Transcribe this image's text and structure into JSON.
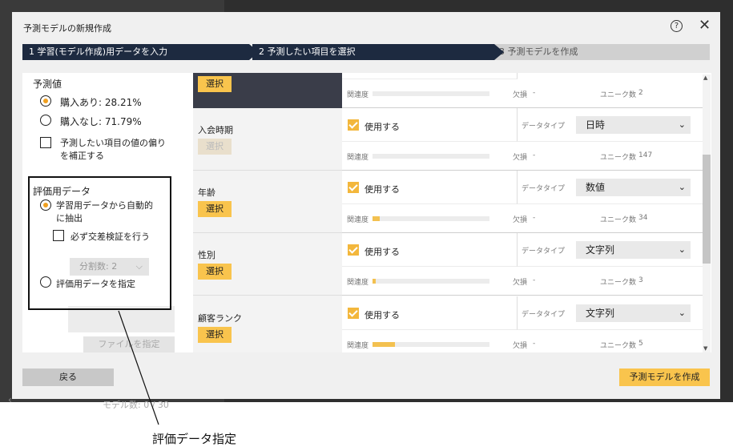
{
  "background": {
    "footer_text": "モデル数: 0 / 30",
    "back_arrow": "‹"
  },
  "dialog": {
    "title": "予測モデルの新規作成",
    "help_icon": "?",
    "close_icon": "✕",
    "steps": [
      {
        "label": "1 学習(モデル作成)用データを入力",
        "state": "done"
      },
      {
        "label": "2 予測したい項目を選択",
        "state": "active"
      },
      {
        "label": "3 予測モデルを作成",
        "state": "pending"
      }
    ]
  },
  "left_panel": {
    "prediction_heading": "予測値",
    "options": [
      {
        "label": "購入あり: 28.21%",
        "selected": true
      },
      {
        "label": "購入なし: 71.79%",
        "selected": false
      }
    ],
    "bias_correct_line1": "予測したい項目の値の偏り",
    "bias_correct_line2": "を補正する",
    "eval_heading": "評価用データ",
    "eval_auto_line1": "学習用データから自動的",
    "eval_auto_line2": "に抽出",
    "cross_validation": "必ず交差検証を行う",
    "splits_select": "分割数: 2",
    "eval_specify": "評価用データを指定",
    "file_button": "ファイルを指定"
  },
  "right_panel": {
    "select_label": "選択",
    "use_label": "使用する",
    "datatype_label": "データタイプ",
    "relevance_label": "関連度",
    "missing_label": "欠損",
    "missing_value": "-",
    "unique_label": "ユニーク数",
    "top_row": {
      "unique": "2",
      "relevance": 0.0
    },
    "rows": [
      {
        "name": "入会時期",
        "datatype": "日時",
        "unique": "147",
        "relevance": 0.0,
        "select_disabled": true
      },
      {
        "name": "年齢",
        "datatype": "数値",
        "unique": "34",
        "relevance": 0.06,
        "select_disabled": false
      },
      {
        "name": "性別",
        "datatype": "文字列",
        "unique": "3",
        "relevance": 0.03,
        "select_disabled": false
      },
      {
        "name": "顧客ランク",
        "datatype": "文字列",
        "unique": "5",
        "relevance": 0.19,
        "select_disabled": false
      }
    ]
  },
  "footer": {
    "back_button": "戻る",
    "create_button": "予測モデルを作成"
  },
  "annotation": {
    "text": "評価データ指定"
  },
  "colors": {
    "accent": "#f9c44d",
    "step_active": "#1d2a40",
    "step_pending": "#d0d0d0"
  }
}
